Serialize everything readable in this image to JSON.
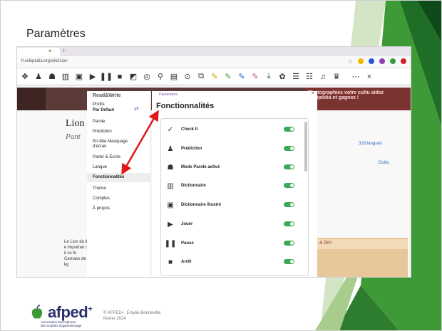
{
  "slide": {
    "title": "Paramètres",
    "footer_brand": "afped",
    "footer_brand_sup": "+",
    "footer_tagline_1": "Association francophone",
    "footer_tagline_2": "des troubles d'apprentissage",
    "footer_copyright_1": "© AFPED+, Emylie Bonneville,",
    "footer_copyright_2": "février 2024",
    "accent_green": "#3a8f3a",
    "arrow_color": "#e01818"
  },
  "browser": {
    "url": "fr.wikipedia.org/wiki/Lion"
  },
  "wiki": {
    "title": "Lion",
    "subtitle": "Pant",
    "banner_right": "Photographies votre cultu aidez Wikipédia et gagnez !",
    "langs": "326 langues",
    "tools": "Outils",
    "lead_text": "Le Lion du lion e importan ou il se fo Carnass de 7 kg",
    "right_header": "a leo"
  },
  "readwrite": {
    "logo": "Read&Write",
    "settings_label": "Paramètres",
    "menu": {
      "profils": "Profils",
      "default": "Par Défaut",
      "parole": "Parole",
      "prediction": "Prédiction",
      "entete": "En-tête Masquage d'écran",
      "parler": "Parler & Écrire",
      "langue": "Langue",
      "fonctionnalites": "Fonctionnalités",
      "theme": "Thème",
      "comptes": "Comptes",
      "apropos": "À propos"
    },
    "content_title": "Fonctionnalités",
    "features": [
      {
        "label": "Check It",
        "icon": "check-it-icon"
      },
      {
        "label": "Prédiction",
        "icon": "prediction-icon"
      },
      {
        "label": "Mode Parole activé",
        "icon": "speech-mode-icon"
      },
      {
        "label": "Dictionnaire",
        "icon": "dictionary-icon"
      },
      {
        "label": "Dictionnaire illustré",
        "icon": "picture-dictionary-icon"
      },
      {
        "label": "Jouer",
        "icon": "play-icon"
      },
      {
        "label": "Pause",
        "icon": "pause-icon"
      },
      {
        "label": "Arrêt",
        "icon": "stop-icon"
      }
    ]
  }
}
